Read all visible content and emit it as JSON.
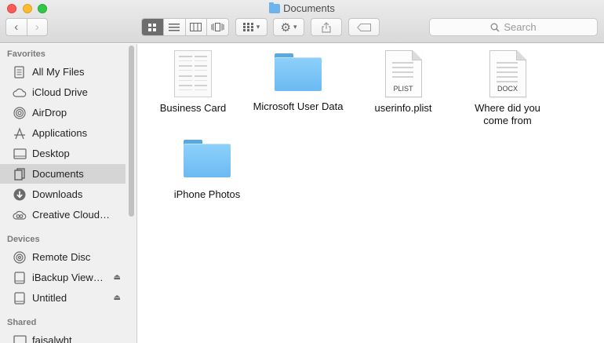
{
  "window": {
    "title": "Documents"
  },
  "toolbar": {
    "back_glyph": "‹",
    "forward_glyph": "›",
    "search_placeholder": "Search"
  },
  "sidebar": {
    "sections": [
      {
        "title": "Favorites"
      },
      {
        "title": "Devices"
      },
      {
        "title": "Shared"
      }
    ],
    "favorites": [
      {
        "label": "All My Files",
        "icon": "all-files-icon"
      },
      {
        "label": "iCloud Drive",
        "icon": "cloud-icon"
      },
      {
        "label": "AirDrop",
        "icon": "airdrop-icon"
      },
      {
        "label": "Applications",
        "icon": "applications-icon"
      },
      {
        "label": "Desktop",
        "icon": "desktop-icon"
      },
      {
        "label": "Documents",
        "icon": "documents-icon",
        "selected": true
      },
      {
        "label": "Downloads",
        "icon": "downloads-icon"
      },
      {
        "label": "Creative Cloud…",
        "icon": "creative-cloud-icon"
      }
    ],
    "devices": [
      {
        "label": "Remote Disc",
        "icon": "disc-icon"
      },
      {
        "label": "iBackup View…",
        "icon": "drive-icon",
        "eject": true
      },
      {
        "label": "Untitled",
        "icon": "drive-icon",
        "eject": true
      }
    ],
    "shared": [
      {
        "label": "faisalwht",
        "icon": "network-computer-icon"
      }
    ]
  },
  "files": [
    {
      "name": "Business Card",
      "type": "card"
    },
    {
      "name": "Microsoft User Data",
      "type": "folder"
    },
    {
      "name": "userinfo.plist",
      "type": "doc",
      "ext": "PLIST"
    },
    {
      "name": "Where did you come from",
      "type": "doc",
      "ext": "DOCX"
    },
    {
      "name": "iPhone Photos",
      "type": "folder"
    }
  ],
  "colors": {
    "folder_blue": "#6bbaf2",
    "selection_gray": "#d5d5d5",
    "close": "#fc5b57",
    "minimize": "#fdbb2e",
    "maximize": "#33c748"
  }
}
